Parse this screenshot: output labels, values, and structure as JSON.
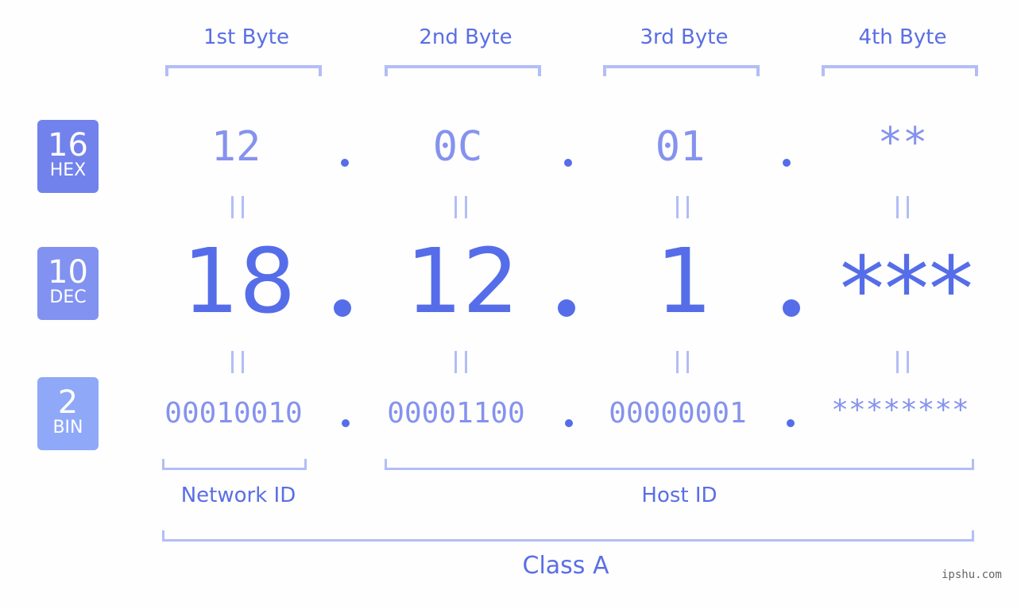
{
  "bytes": [
    {
      "label": "1st Byte",
      "hex": "12",
      "dec": "18",
      "bin": "00010010"
    },
    {
      "label": "2nd Byte",
      "hex": "0C",
      "dec": "12",
      "bin": "00001100"
    },
    {
      "label": "3rd Byte",
      "hex": "01",
      "dec": "1",
      "bin": "00000001"
    },
    {
      "label": "4th Byte",
      "hex": "**",
      "dec": "***",
      "bin": "********"
    }
  ],
  "badges": {
    "hex": {
      "num": "16",
      "label": "HEX",
      "color": "#7182ec"
    },
    "dec": {
      "num": "10",
      "label": "DEC",
      "color": "#8192f1"
    },
    "bin": {
      "num": "2",
      "label": "BIN",
      "color": "#8fa8f8"
    }
  },
  "segments": {
    "network": "Network ID",
    "host": "Host ID",
    "class": "Class A"
  },
  "watermark": "ipshu.com",
  "colors": {
    "accent": "#566de9",
    "light": "#8592ee",
    "bracket": "#b3bdf7"
  }
}
